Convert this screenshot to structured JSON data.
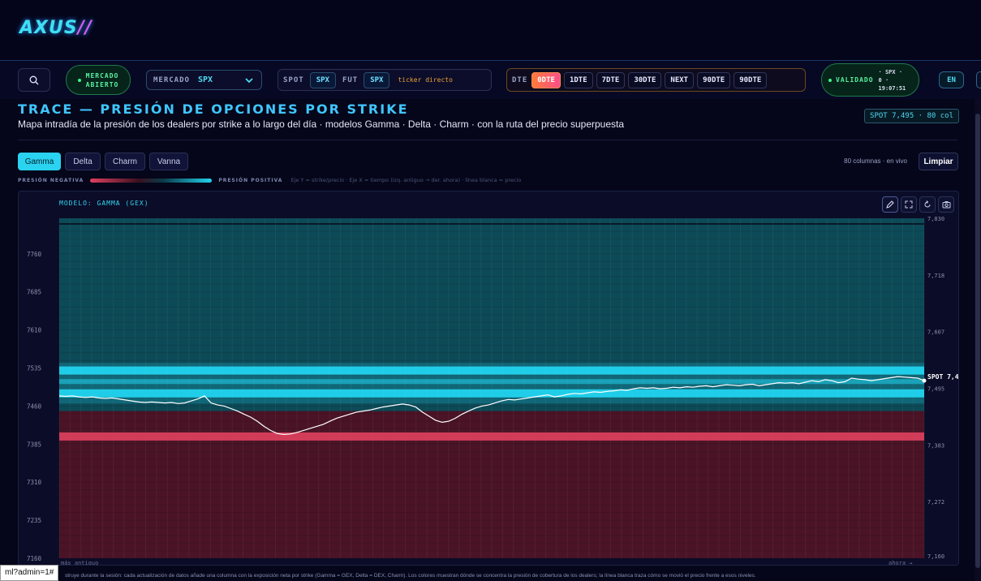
{
  "app": {
    "logo": "AXUS"
  },
  "controls": {
    "market_status": [
      "MERCADO",
      "ABIERTO"
    ],
    "market_label": "MERCADO",
    "market_value": "SPX",
    "spot_label": "SPOT",
    "spot_value": "SPX",
    "fut_label": "FUT",
    "fut_value": "SPX",
    "ticker_label": "ticker directo",
    "dte_label": "DTE",
    "dte_options": [
      "0DTE",
      "1DTE",
      "7DTE",
      "30DTE",
      "NEXT",
      "90DTE",
      "90DTE"
    ],
    "dte_selected": "0DTE",
    "validated_label": "VALIDADO",
    "validated_symbol": "· SPX ·",
    "validated_count": "0 ·",
    "validated_time": "19:07:51",
    "lang": "EN"
  },
  "page": {
    "title": "TRACE — PRESIÓN DE OPCIONES POR STRIKE",
    "subtitle": "Mapa intradía de la presión de los dealers por strike a lo largo del día · modelos Gamma · Delta · Charm · con la ruta del precio superpuesta",
    "spot_badge": "SPOT 7,495 · 80 col",
    "tabs": [
      "Gamma",
      "Delta",
      "Charm",
      "Vanna"
    ],
    "active_tab": "Gamma",
    "columns_info": "80 columnas · en vivo",
    "clear_button": "Limpiar",
    "legend_negative": "PRESIÓN NEGATIVA",
    "legend_positive": "PRESIÓN POSITIVA",
    "legend_hint": "Eje Y = strike/precio · Eje X = tiempo (izq. antiguo → der. ahora) · línea blanca = precio",
    "model_label": "MODELO: GAMMA (GEX)",
    "x_left_label": "más antiguo",
    "x_right_label": "ahora →",
    "spot_marker": "SPOT 7,4",
    "footer": "struye durante la sesión: cada actualización de datos añade una columna con la exposición neta por strike (Gamma = GEX, Delta = DEX, Charm). Los colores muestran dónde se concentra la presión de cobertura de los dealers; la línea blanca traza cómo se movió el precio frente a esos niveles.",
    "url_popup": "ml?admin=1#"
  },
  "colors": {
    "positive": "#22d3ee",
    "negative": "#e0405e",
    "price_line": "#ffffff"
  },
  "chart_data": {
    "type": "heatmap",
    "title": "MODELO: GAMMA (GEX)",
    "columns": 80,
    "left_axis_ticks": [
      7760,
      7685,
      7610,
      7535,
      7460,
      7385,
      7310,
      7235,
      7160
    ],
    "right_axis_ticks": [
      "7,830",
      "7,718",
      "7,607",
      "7,495",
      "7,383",
      "7,272",
      "7,160"
    ],
    "ylim": [
      7160,
      7830
    ],
    "spot": 7495,
    "positive_band_levels": [
      7530,
      7505,
      7485
    ],
    "negative_band_level": 7400,
    "price_path": [
      7480,
      7479,
      7480,
      7478,
      7477,
      7478,
      7476,
      7475,
      7476,
      7474,
      7472,
      7470,
      7468,
      7467,
      7468,
      7467,
      7466,
      7467,
      7465,
      7466,
      7470,
      7474,
      7480,
      7466,
      7462,
      7460,
      7455,
      7450,
      7444,
      7438,
      7430,
      7420,
      7412,
      7406,
      7404,
      7405,
      7408,
      7412,
      7416,
      7420,
      7424,
      7430,
      7436,
      7440,
      7444,
      7448,
      7450,
      7452,
      7455,
      7458,
      7460,
      7462,
      7464,
      7462,
      7458,
      7448,
      7440,
      7432,
      7428,
      7430,
      7436,
      7444,
      7450,
      7456,
      7460,
      7462,
      7466,
      7470,
      7473,
      7472,
      7474,
      7476,
      7478,
      7480,
      7482,
      7478,
      7480,
      7483,
      7485,
      7484,
      7486,
      7488,
      7487,
      7489,
      7490,
      7492,
      7491,
      7494,
      7496,
      7495,
      7496,
      7494,
      7495,
      7497,
      7496,
      7498,
      7497,
      7499,
      7500,
      7498,
      7500,
      7502,
      7501,
      7500,
      7502,
      7503,
      7500,
      7502,
      7504,
      7506,
      7505,
      7506,
      7504,
      7507,
      7510,
      7508,
      7512,
      7510,
      7506,
      7508,
      7515,
      7513,
      7512,
      7510,
      7512,
      7514,
      7516,
      7518,
      7517,
      7516,
      7515,
      7510
    ]
  }
}
